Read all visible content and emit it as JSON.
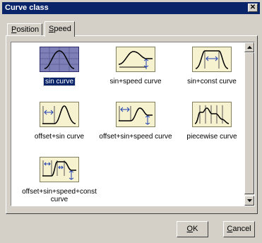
{
  "window": {
    "title": "Curve class",
    "close_glyph": "✕"
  },
  "tabs": [
    {
      "label": "Position",
      "mnemonic": "P",
      "rest": "osition",
      "active": false
    },
    {
      "label": "Speed",
      "mnemonic": "S",
      "rest": "peed",
      "active": true
    }
  ],
  "items": [
    {
      "label": "sin curve",
      "icon": "sin-curve-icon",
      "selected": true
    },
    {
      "label": "sin+speed curve",
      "icon": "sin-speed-curve-icon",
      "selected": false
    },
    {
      "label": "sin+const curve",
      "icon": "sin-const-curve-icon",
      "selected": false
    },
    {
      "label": "offset+sin curve",
      "icon": "offset-sin-curve-icon",
      "selected": false
    },
    {
      "label": "offset+sin+speed curve",
      "icon": "offset-sin-speed-curve-icon",
      "selected": false
    },
    {
      "label": "piecewise curve",
      "icon": "piecewise-curve-icon",
      "selected": false
    },
    {
      "label": "offset+sin+speed+const curve",
      "icon": "offset-sin-speed-const-curve-icon",
      "selected": false
    }
  ],
  "buttons": {
    "ok": {
      "label": "OK",
      "mnemonic": "O",
      "rest": "K"
    },
    "cancel": {
      "label": "Cancel",
      "mnemonic": "C",
      "rest": "ancel"
    }
  },
  "colors": {
    "title_bar": "#0a246a",
    "icon_bg": "#f6f1cf",
    "selection": "#0a246a"
  }
}
